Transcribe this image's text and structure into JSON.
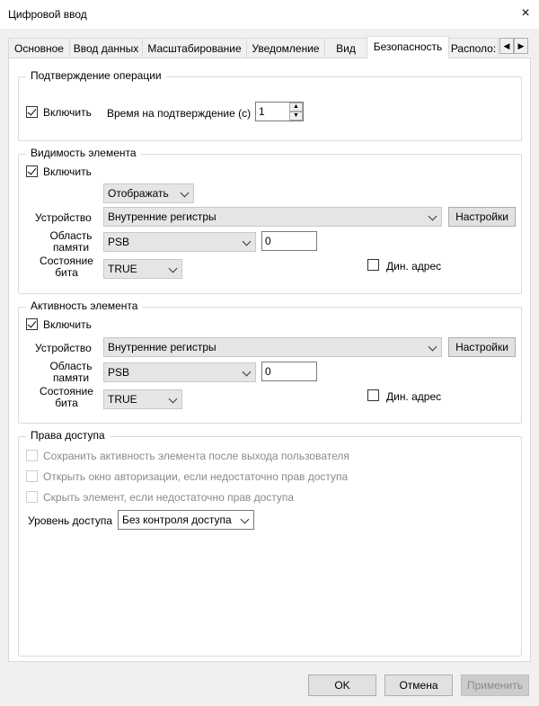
{
  "window": {
    "title": "Цифровой ввод",
    "close_icon": "×"
  },
  "tabs": [
    {
      "label": "Основное"
    },
    {
      "label": "Ввод данных"
    },
    {
      "label": "Масштабирование"
    },
    {
      "label": "Уведомление"
    },
    {
      "label": "Вид"
    },
    {
      "label": "Безопасность",
      "active": true
    },
    {
      "label": "Располо:"
    }
  ],
  "tab_scroll": {
    "left": "◀",
    "right": "▶"
  },
  "confirm": {
    "title": "Подтверждение операции",
    "enable_label": "Включить",
    "enable_checked": true,
    "time_label": "Время на подтверждение (с)",
    "time_value": "1"
  },
  "visibility": {
    "title": "Видимость элемента",
    "enable_label": "Включить",
    "enable_checked": true,
    "mode_value": "Отображать",
    "device_label": "Устройство",
    "device_value": "Внутренние регистры",
    "settings_label": "Настройки",
    "memory_label_1": "Область",
    "memory_label_2": "памяти",
    "memory_value": "PSB",
    "address_value": "0",
    "bit_label_1": "Состояние",
    "bit_label_2": "бита",
    "bit_value": "TRUE",
    "dyn_label": "Дин. адрес",
    "dyn_checked": false
  },
  "activity": {
    "title": "Активность элемента",
    "enable_label": "Включить",
    "enable_checked": true,
    "device_label": "Устройство",
    "device_value": "Внутренние регистры",
    "settings_label": "Настройки",
    "memory_label_1": "Область",
    "memory_label_2": "памяти",
    "memory_value": "PSB",
    "address_value": "0",
    "bit_label_1": "Состояние",
    "bit_label_2": "бита",
    "bit_value": "TRUE",
    "dyn_label": "Дин. адрес",
    "dyn_checked": false
  },
  "access": {
    "title": "Права доступа",
    "option1": "Сохранить активность элемента после выхода пользователя",
    "option2": "Открыть окно авторизации, если недостаточно прав доступа",
    "option3": "Скрыть элемент, если недостаточно прав доступа",
    "level_label": "Уровень доступа",
    "level_value": "Без контроля доступа"
  },
  "footer": {
    "ok": "OK",
    "cancel": "Отмена",
    "apply": "Применить"
  }
}
